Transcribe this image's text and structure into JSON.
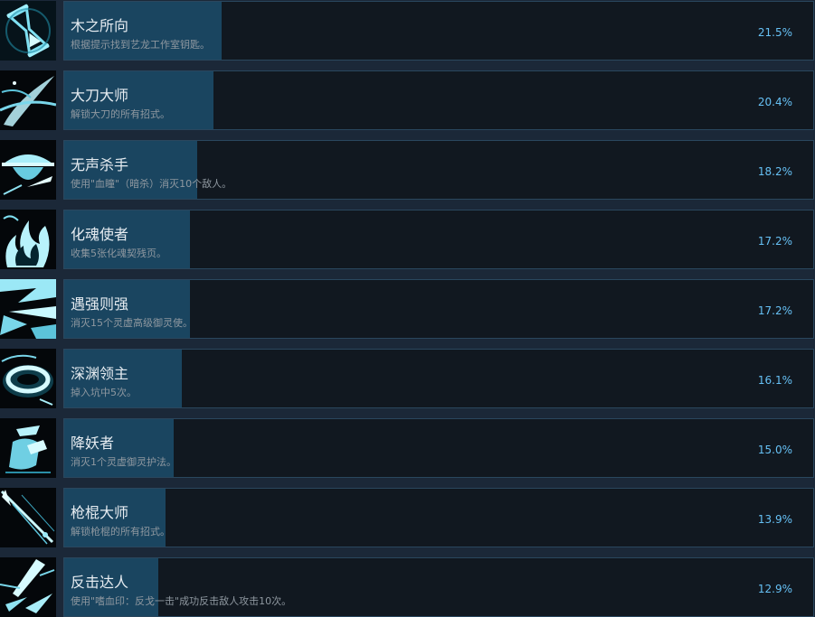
{
  "achievements": [
    {
      "icon": "hourglass-icon",
      "title": "木之所向",
      "description": "根据提示找到艺龙工作室钥匙。",
      "percent": "21.5%",
      "value": 21.5
    },
    {
      "icon": "blade-slash-icon",
      "title": "大刀大师",
      "description": "解锁大刀的所有招式。",
      "percent": "20.4%",
      "value": 20.4
    },
    {
      "icon": "straw-hat-icon",
      "title": "无声杀手",
      "description": "使用\"血瞳\"（暗杀）消灭10个敌人。",
      "percent": "18.2%",
      "value": 18.2
    },
    {
      "icon": "spirit-flame-icon",
      "title": "化魂使者",
      "description": "收集5张化魂契残页。",
      "percent": "17.2%",
      "value": 17.2
    },
    {
      "icon": "shatter-burst-icon",
      "title": "遇强则强",
      "description": "消灭15个灵虚高级御灵使。",
      "percent": "17.2%",
      "value": 17.2
    },
    {
      "icon": "abyss-pit-icon",
      "title": "深渊领主",
      "description": "掉入坑中5次。",
      "percent": "16.1%",
      "value": 16.1
    },
    {
      "icon": "demon-queller-icon",
      "title": "降妖者",
      "description": "消灭1个灵虚御灵护法。",
      "percent": "15.0%",
      "value": 15.0
    },
    {
      "icon": "spear-staff-icon",
      "title": "枪棍大师",
      "description": "解锁枪棍的所有招式。",
      "percent": "13.9%",
      "value": 13.9
    },
    {
      "icon": "counter-strike-icon",
      "title": "反击达人",
      "description": "使用\"嗜血印：反戈一击\"成功反击敌人攻击10次。",
      "percent": "12.9%",
      "value": 12.9
    }
  ],
  "colors": {
    "background": "#1b2838",
    "card": "#111820",
    "card_border": "#2a475e",
    "progress_fill": "#1a4560",
    "title": "#e6ecf1",
    "description": "#8f98a0",
    "percent": "#66c0f4",
    "icon_accent": "#8fe3f2"
  }
}
